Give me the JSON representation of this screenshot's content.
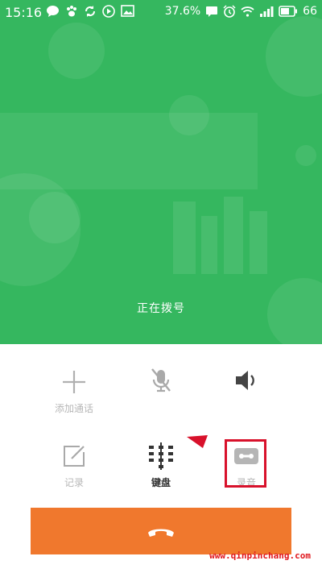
{
  "status_bar": {
    "time": "15:16",
    "battery_percent_text": "37.6%",
    "battery_level": "66",
    "left_icons": [
      "message-icon",
      "paw-icon",
      "sync-icon",
      "play-icon",
      "image-icon"
    ],
    "right_icons": [
      "chat-icon",
      "alarm-icon",
      "wifi-icon",
      "signal-icon",
      "battery-icon"
    ]
  },
  "call": {
    "status_text": "正在拨号",
    "background_color": "#35b75f"
  },
  "controls": [
    {
      "id": "add-call",
      "label": "添加通话",
      "icon": "plus-icon"
    },
    {
      "id": "mute",
      "label": "",
      "icon": "mic-off-icon"
    },
    {
      "id": "speaker",
      "label": "",
      "icon": "speaker-icon"
    },
    {
      "id": "notes",
      "label": "记录",
      "icon": "note-edit-icon"
    },
    {
      "id": "keypad",
      "label": "键盘",
      "icon": "keypad-icon"
    },
    {
      "id": "record",
      "label": "录音",
      "icon": "tape-record-icon"
    }
  ],
  "hangup": {
    "icon": "phone-hangup-icon",
    "color": "#f0782d"
  },
  "watermark": "www.qinpinchang.com",
  "highlight_color": "#d8112b"
}
